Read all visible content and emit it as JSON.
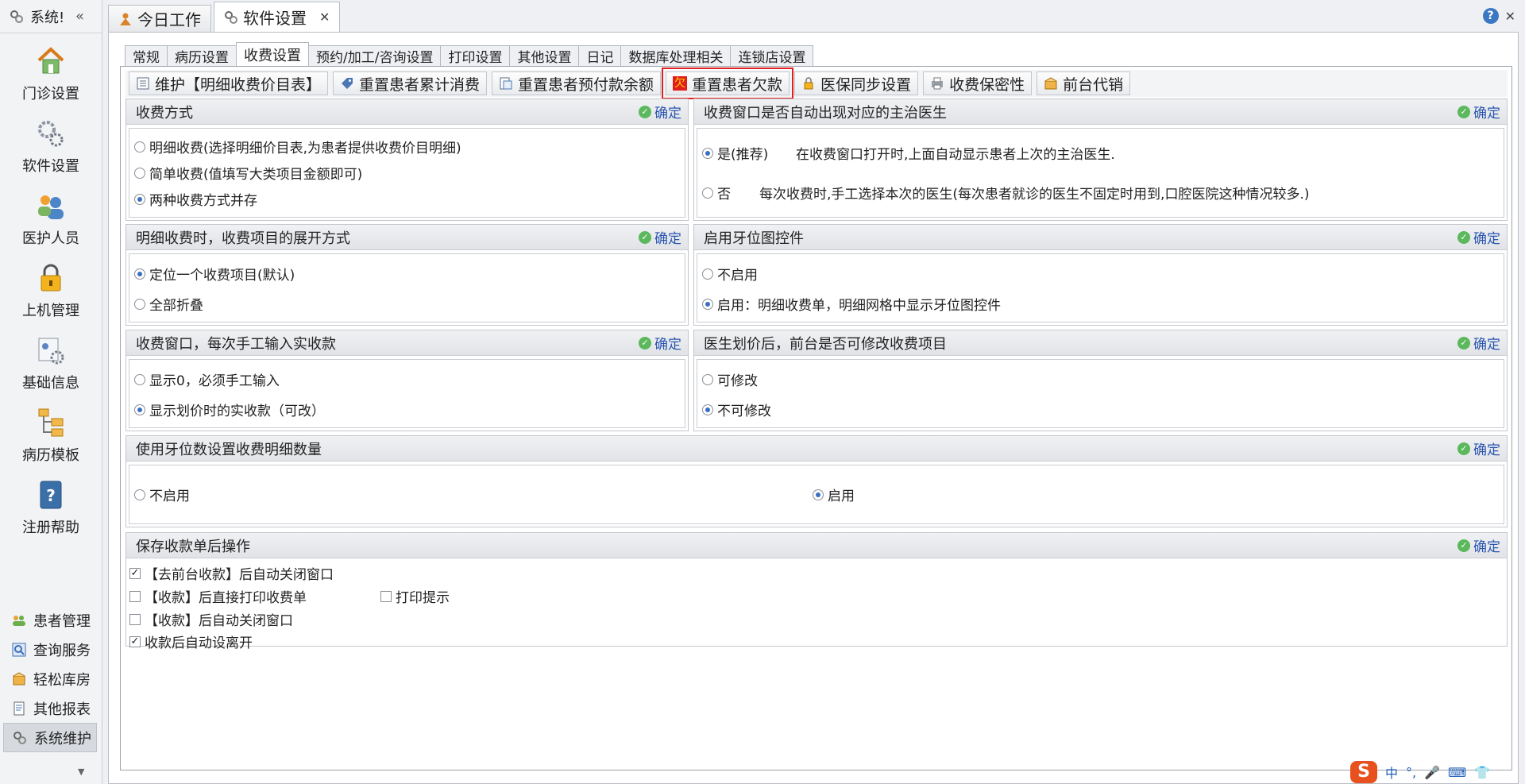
{
  "sidebar": {
    "title": "系统!",
    "collapse_glyph": "«",
    "big_items": [
      {
        "label": "门诊设置"
      },
      {
        "label": "软件设置"
      },
      {
        "label": "医护人员"
      },
      {
        "label": "上机管理"
      },
      {
        "label": "基础信息"
      },
      {
        "label": "病历模板"
      },
      {
        "label": "注册帮助"
      }
    ],
    "small_items": [
      {
        "label": "患者管理"
      },
      {
        "label": "查询服务"
      },
      {
        "label": "轻松库房"
      },
      {
        "label": "其他报表"
      },
      {
        "label": "系统维护"
      }
    ]
  },
  "doc_tabs": [
    {
      "label": "今日工作"
    },
    {
      "label": "软件设置",
      "close": "✕"
    }
  ],
  "top_right": {
    "help": "?",
    "close": "✕"
  },
  "settings_tabs": [
    "常规",
    "病历设置",
    "收费设置",
    "预约/加工/咨询设置",
    "打印设置",
    "其他设置",
    "日记",
    "数据库处理相关",
    "连锁店设置"
  ],
  "toolbar": {
    "buttons": [
      {
        "label": "维护【明细收费价目表】",
        "icon": "list-icon"
      },
      {
        "label": "重置患者累计消费",
        "icon": "tag-icon"
      },
      {
        "label": "重置患者预付款余额",
        "icon": "document-icon"
      },
      {
        "label": "重置患者欠款",
        "icon": "debt-icon",
        "badge": "欠"
      },
      {
        "label": "医保同步设置",
        "icon": "lock-icon"
      },
      {
        "label": "收费保密性",
        "icon": "printer-icon"
      },
      {
        "label": "前台代销",
        "icon": "box-icon"
      }
    ]
  },
  "confirm_label": "确定",
  "panels": {
    "fee_method": {
      "title": "收费方式",
      "options": [
        "明细收费(选择明细价目表,为患者提供收费价目明细)",
        "简单收费(值填写大类项目金额即可)",
        "两种收费方式并存"
      ],
      "selected": 2
    },
    "auto_doctor": {
      "title": "收费窗口是否自动出现对应的主治医生",
      "options": [
        {
          "label": "是(推荐)",
          "desc": "在收费窗口打开时,上面自动显示患者上次的主治医生."
        },
        {
          "label": "否",
          "desc": "每次收费时,手工选择本次的医生(每次患者就诊的医生不固定时用到,口腔医院这种情况较多.)"
        }
      ],
      "selected": 0
    },
    "expand_mode": {
      "title": "明细收费时，收费项目的展开方式",
      "options": [
        "定位一个收费项目(默认)",
        "全部折叠"
      ],
      "selected": 0
    },
    "tooth_chart": {
      "title": "启用牙位图控件",
      "options": [
        "不启用",
        "启用：明细收费单，明细网格中显示牙位图控件"
      ],
      "selected": 1
    },
    "manual_input": {
      "title": "收费窗口，每次手工输入实收款",
      "options": [
        "显示0，必须手工输入",
        "显示划价时的实收款（可改）"
      ],
      "selected": 1
    },
    "modify_items": {
      "title": "医生划价后，前台是否可修改收费项目",
      "options": [
        "可修改",
        "不可修改"
      ],
      "selected": 1
    },
    "tooth_count": {
      "title": "使用牙位数设置收费明细数量",
      "options": [
        "不启用",
        "启用"
      ],
      "selected": 1
    },
    "after_save": {
      "title": "保存收款单后操作",
      "checks": [
        {
          "label": "【去前台收款】后自动关闭窗口",
          "checked": true
        },
        {
          "label": "【收款】后直接打印收费单",
          "checked": false
        },
        {
          "label": "【收款】后自动关闭窗口",
          "checked": false
        },
        {
          "label": "收款后自动设离开",
          "checked": true
        }
      ],
      "extra_check": {
        "label": "打印提示",
        "checked": false
      }
    }
  },
  "ime": {
    "logo": "S",
    "mode": "中",
    "punct": "°,"
  }
}
